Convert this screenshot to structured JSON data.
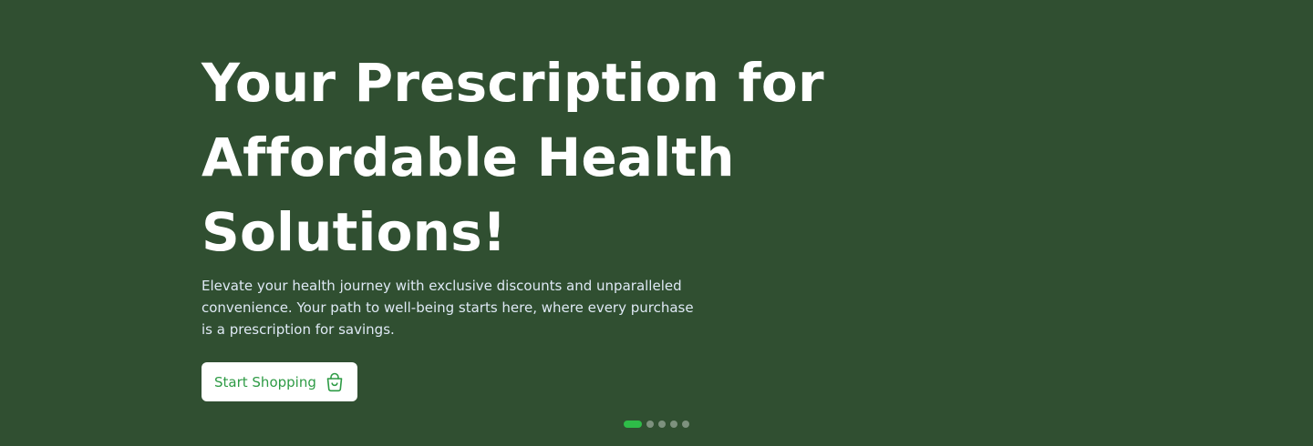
{
  "hero": {
    "title_lines": [
      "Your Prescription for",
      "Affordable Health",
      "Solutions!"
    ],
    "subtitle_lines": [
      "Elevate your health journey with exclusive discounts and unparalleled",
      "convenience. Your path to well-being starts here, where every purchase",
      "is a prescription for savings."
    ],
    "cta": {
      "label": "Start Shopping",
      "icon": "shopping-bag-icon"
    }
  },
  "carousel": {
    "slide_count": 5,
    "active_index": 0
  },
  "colors": {
    "background": "#304f31",
    "title": "#ffffff",
    "subtitle": "#dfe9f5",
    "accent": "#2e9b45",
    "dot_active": "#2ebc48",
    "dot_inactive": "#7d917e"
  }
}
